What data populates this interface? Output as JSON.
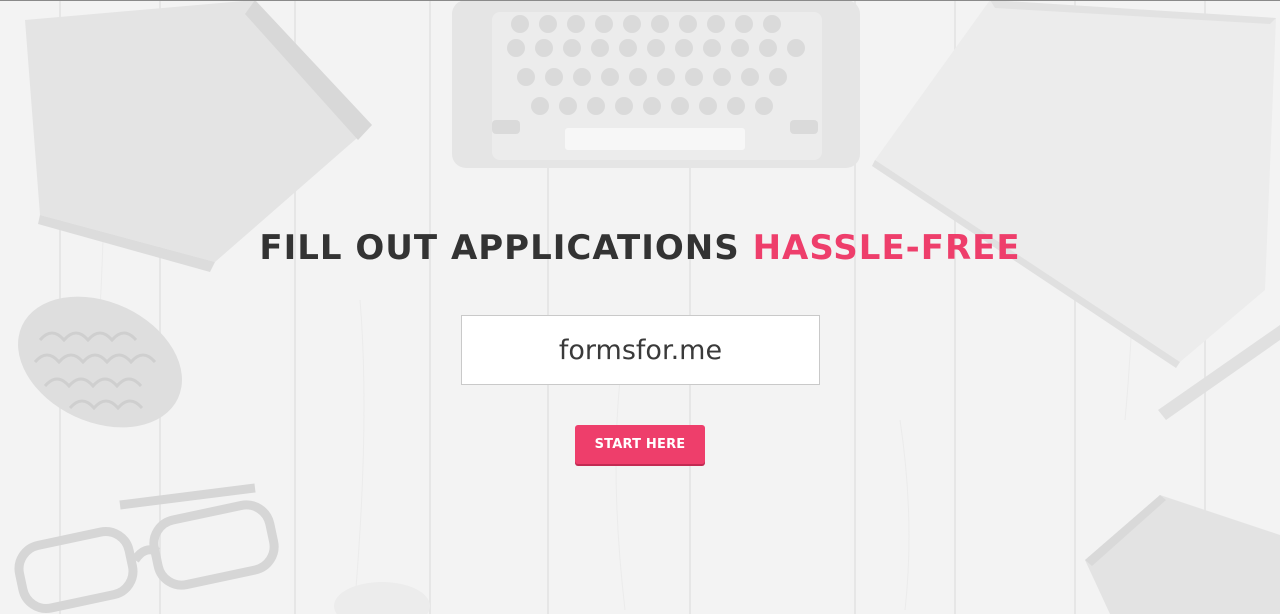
{
  "hero": {
    "headline_dark": "FILL OUT APPLICATIONS ",
    "headline_accent": "HASSLE-FREE",
    "site_field_value": "formsfor.me",
    "start_button_label": "START HERE"
  },
  "colors": {
    "accent": "#ee3e6b",
    "headline_text": "#333333",
    "background": "#f4f4f4"
  }
}
